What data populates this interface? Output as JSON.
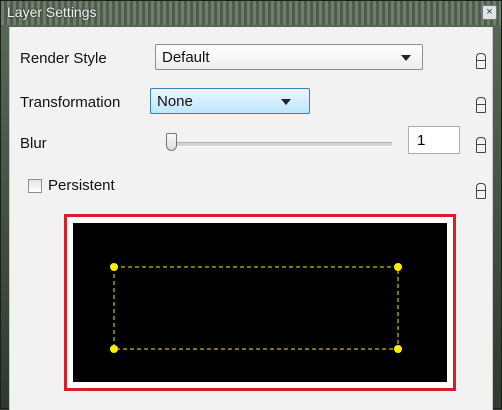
{
  "window": {
    "title": "Layer Settings",
    "close_glyph": "×"
  },
  "render_style": {
    "label": "Render Style",
    "value": "Default"
  },
  "transformation": {
    "label": "Transformation",
    "value": "None"
  },
  "blur": {
    "label": "Blur",
    "value": "1",
    "slider_level": 0.0
  },
  "persistent": {
    "label": "Persistent",
    "checked": false
  },
  "colors": {
    "selection_frame": "#d4202a",
    "canvas": "#000000",
    "handle": "#ffee00",
    "dashed_rect": "#ffee00"
  },
  "icons": {
    "lock": "lock-icon",
    "close": "close-icon"
  }
}
